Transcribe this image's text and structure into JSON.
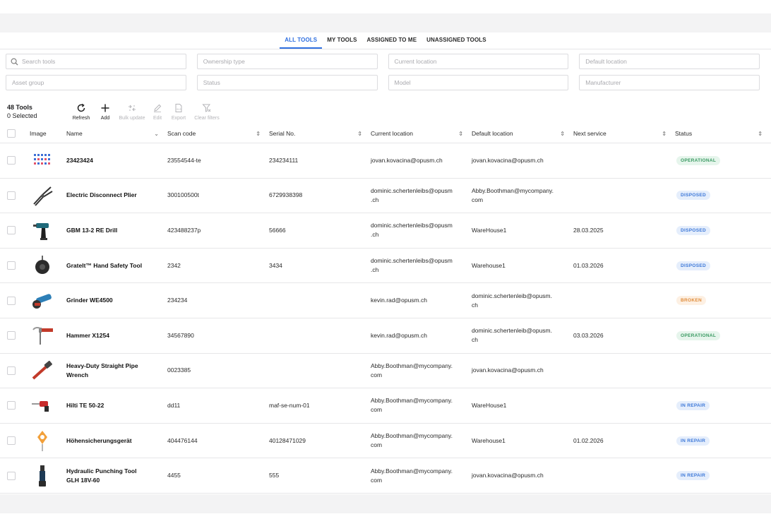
{
  "tabs": [
    {
      "label": "ALL TOOLS",
      "active": true
    },
    {
      "label": "MY TOOLS",
      "active": false
    },
    {
      "label": "ASSIGNED TO ME",
      "active": false
    },
    {
      "label": "UNASSIGNED TOOLS",
      "active": false
    }
  ],
  "filters": {
    "search_placeholder": "Search tools",
    "ownership_type": "Ownership type",
    "current_location": "Current location",
    "default_location": "Default location",
    "asset_group": "Asset group",
    "status": "Status",
    "model": "Model",
    "manufacturer": "Manufacturer"
  },
  "summary": {
    "total": "48 Tools",
    "selected": "0 Selected"
  },
  "toolbar": {
    "refresh": "Refresh",
    "add": "Add",
    "bulk_update": "Bulk update",
    "edit": "Edit",
    "export": "Export",
    "clear_filters": "Clear filters"
  },
  "columns": {
    "image": "Image",
    "name": "Name",
    "scan_code": "Scan code",
    "serial_no": "Serial No.",
    "current_location": "Current location",
    "default_location": "Default location",
    "next_service": "Next service",
    "status": "Status"
  },
  "status_colors": {
    "operational": "#3a9a62",
    "disposed": "#3d78d8",
    "broken": "#e08d3c",
    "in_repair": "#3d78d8"
  },
  "rows": [
    {
      "image": "sticker-sheet-icon",
      "name": "23423424",
      "scan": "23554544-te",
      "serial": "234234111",
      "current": "jovan.kovacina@opusm.ch",
      "default": "jovan.kovacina@opusm.ch",
      "next": "",
      "status": "OPERATIONAL",
      "status_kind": "operational"
    },
    {
      "image": "plier-icon",
      "name": "Electric Disconnect Plier",
      "scan": "300100500t",
      "serial": "6729938398",
      "current": "dominic.schertenleibs@opusm\n.ch",
      "default": "Abby.Boothman@mycompany.\ncom",
      "next": "",
      "status": "DISPOSED",
      "status_kind": "disposed"
    },
    {
      "image": "drill-icon",
      "name": "GBM 13-2 RE Drill",
      "scan": "423488237p",
      "serial": "56666",
      "current": "dominic.schertenleibs@opusm\n.ch",
      "default": "WareHouse1",
      "next": "28.03.2025",
      "status": "DISPOSED",
      "status_kind": "disposed"
    },
    {
      "image": "safety-tool-icon",
      "name": "Gratelt™ Hand Safety Tool",
      "scan": "2342",
      "serial": "3434",
      "current": "dominic.schertenleibs@opusm\n.ch",
      "default": "Warehouse1",
      "next": "01.03.2026",
      "status": "DISPOSED",
      "status_kind": "disposed"
    },
    {
      "image": "grinder-icon",
      "name": "Grinder WE4500",
      "scan": "234234",
      "serial": "",
      "current": "kevin.rad@opusm.ch",
      "default": "dominic.schertenleib@opusm.\nch",
      "next": "",
      "status": "BROKEN",
      "status_kind": "broken"
    },
    {
      "image": "hammer-icon",
      "name": "Hammer X1254",
      "scan": "34567890",
      "serial": "",
      "current": "kevin.rad@opusm.ch",
      "default": "dominic.schertenleib@opusm.\nch",
      "next": "03.03.2026",
      "status": "OPERATIONAL",
      "status_kind": "operational"
    },
    {
      "image": "pipe-wrench-icon",
      "name": "Heavy-Duty Straight Pipe\nWrench",
      "scan": "0023385",
      "serial": "",
      "current": "Abby.Boothman@mycompany.\ncom",
      "default": "jovan.kovacina@opusm.ch",
      "next": "",
      "status": "",
      "status_kind": ""
    },
    {
      "image": "hammer-drill-icon",
      "name": "Hilti TE 50-22",
      "scan": "dd11",
      "serial": "maf-se-num-01",
      "current": "Abby.Boothman@mycompany.\ncom",
      "default": "WareHouse1",
      "next": "",
      "status": "IN REPAIR",
      "status_kind": "repair"
    },
    {
      "image": "fall-arrester-icon",
      "name": "Höhensicherungsgerät",
      "scan": "404476144",
      "serial": "40128471029",
      "current": "Abby.Boothman@mycompany.\ncom",
      "default": "Warehouse1",
      "next": "01.02.2026",
      "status": "IN REPAIR",
      "status_kind": "repair"
    },
    {
      "image": "punching-tool-icon",
      "name": "Hydraulic Punching Tool\nGLH 18V-60",
      "scan": "4455",
      "serial": "555",
      "current": "Abby.Boothman@mycompany.\ncom",
      "default": "jovan.kovacina@opusm.ch",
      "next": "",
      "status": "IN REPAIR",
      "status_kind": "repair"
    }
  ]
}
